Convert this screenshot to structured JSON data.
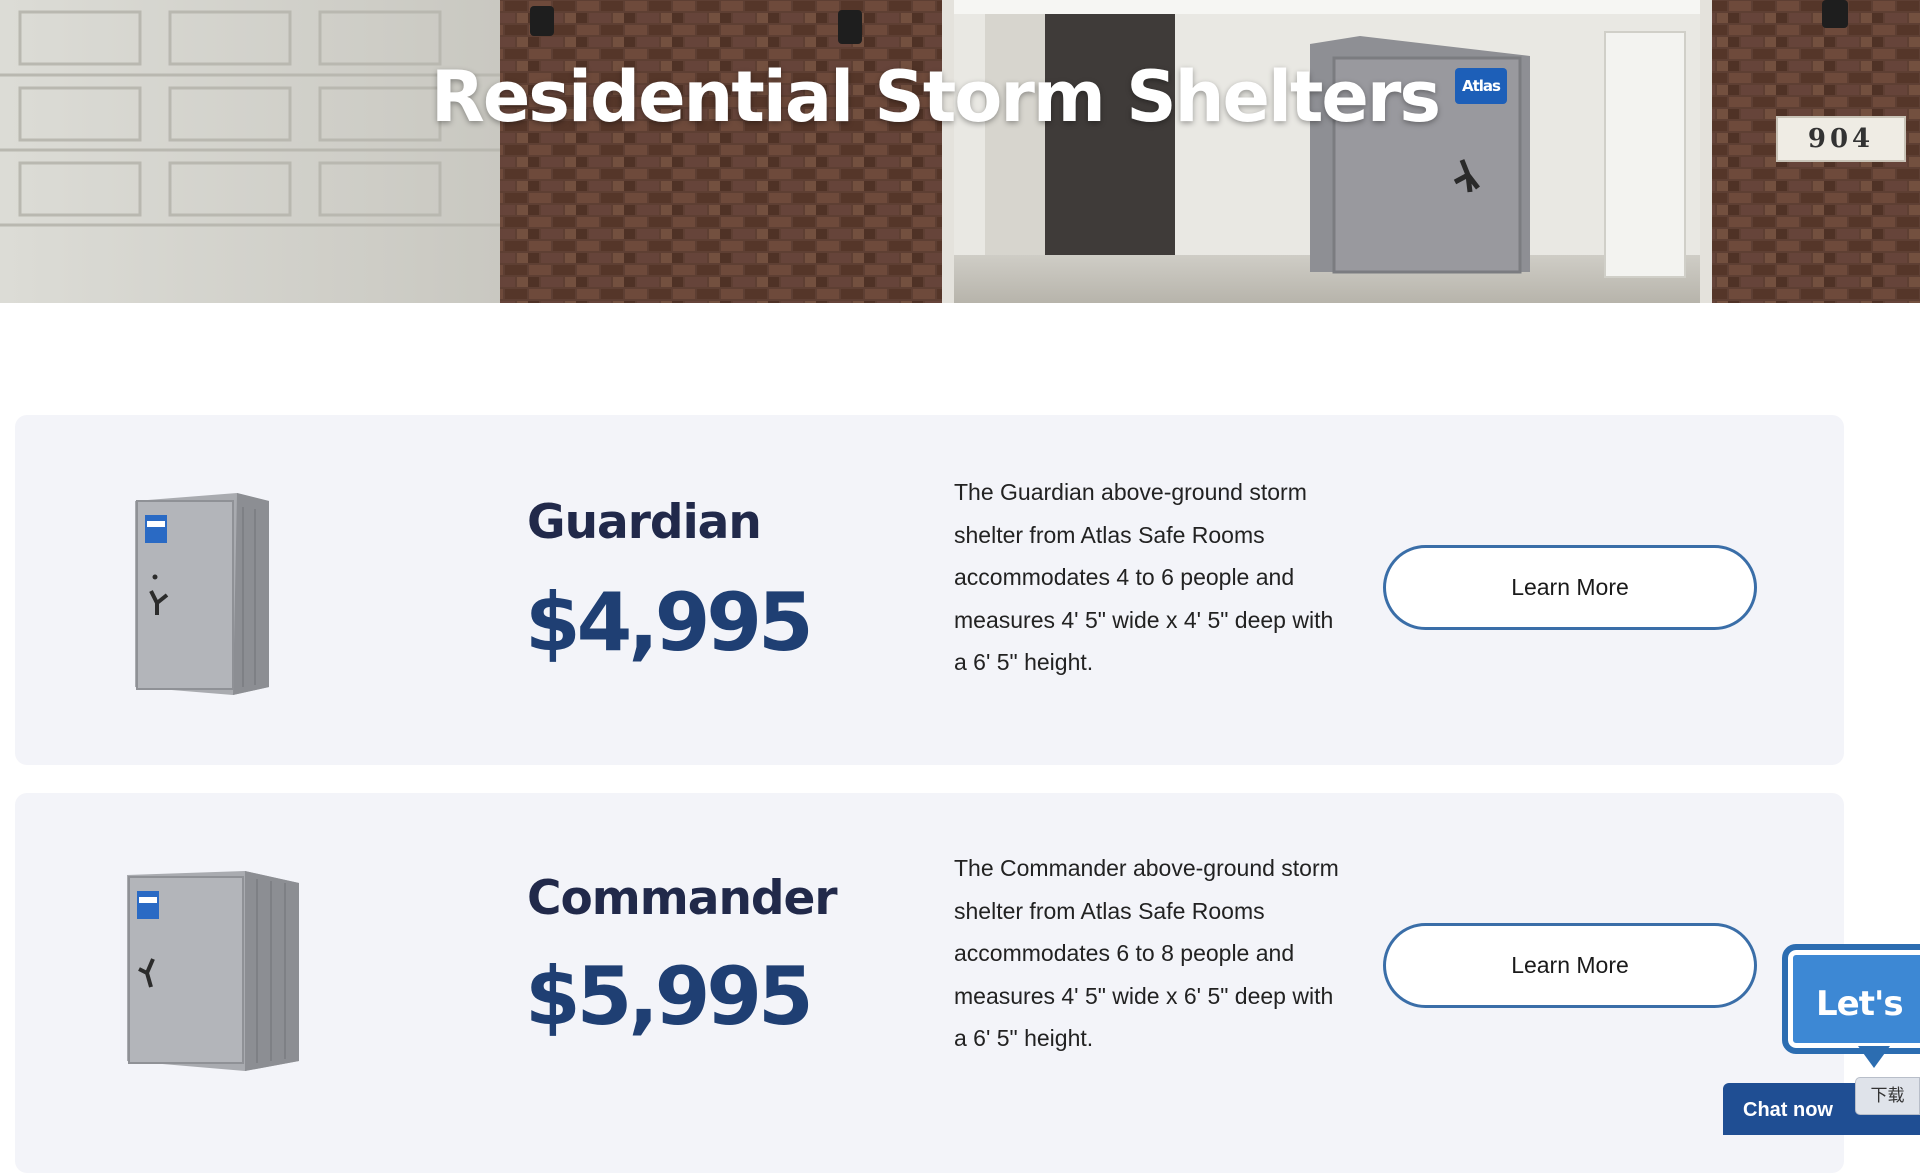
{
  "hero": {
    "title": "Residential Storm Shelters",
    "house_number": "904",
    "shelter_badge": "Atlas"
  },
  "products": [
    {
      "name": "Guardian",
      "price": "$4,995",
      "description": "The Guardian above-ground storm shelter from Atlas Safe Rooms accommodates 4 to 6 people and measures 4' 5\" wide x 4' 5\" deep with a 6' 5\" height.",
      "button_label": "Learn More"
    },
    {
      "name": "Commander",
      "price": "$5,995",
      "description": "The Commander above-ground storm shelter from Atlas Safe Rooms accommodates 6 to 8 people and measures 4' 5\" wide x 6' 5\" deep with a 6' 5\" height.",
      "button_label": "Learn More"
    }
  ],
  "chat": {
    "bubble_text": "Let's",
    "button_label": "Chat now",
    "download_label": "下载"
  },
  "colors": {
    "card_background": "#f3f4f9",
    "heading": "#21294a",
    "price": "#1f3f73",
    "button_border": "#3a6ea8",
    "chat_blue": "#1f4e93"
  }
}
